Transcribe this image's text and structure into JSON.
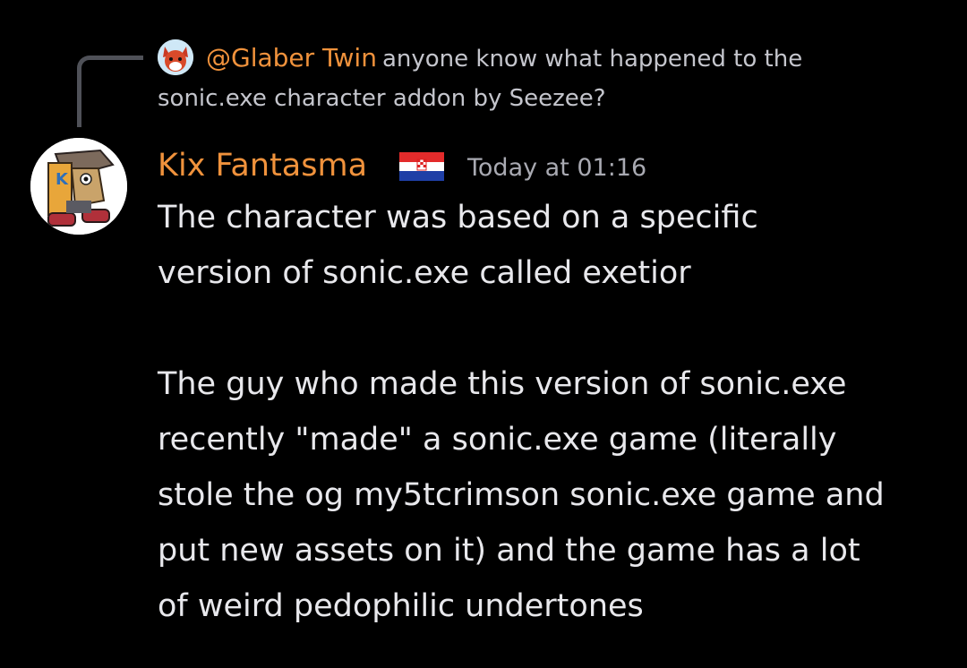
{
  "reply": {
    "author": "@Glaber Twin",
    "text_line1": "anyone know what happened to the",
    "text_line2": "sonic.exe character addon by Seezee?"
  },
  "message": {
    "author": "Kix Fantasma",
    "flag": "croatia-flag",
    "timestamp": "Today at 01:16",
    "paragraph1": [
      "The character was based on a specific",
      "version of sonic.exe called exetior"
    ],
    "paragraph2": [
      "The guy who made this version of sonic.exe",
      "recently \"made\" a sonic.exe game (literally",
      "stole the og my5tcrimson sonic.exe game and",
      "put new assets on it) and the game has a lot",
      "of weird pedophilic undertones"
    ]
  },
  "colors": {
    "background": "#000000",
    "username": "#f0923c",
    "reply_line": "#4f5158",
    "message_text": "#e8e8ec",
    "muted_text": "#a9aab2"
  }
}
